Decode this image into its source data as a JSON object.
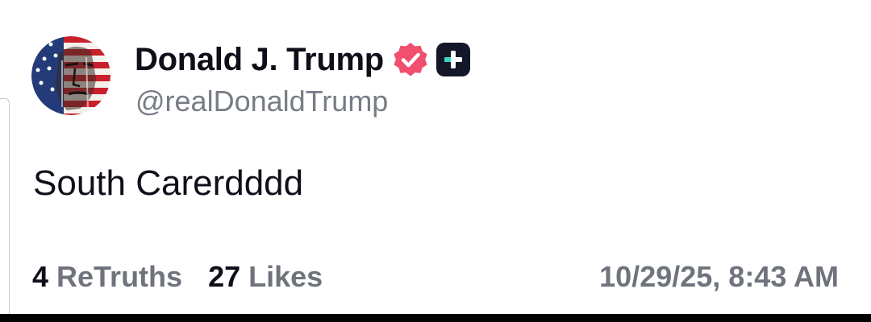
{
  "post": {
    "author": {
      "display_name": "Donald J. Trump",
      "handle": "@realDonaldTrump",
      "verified_icon": "verified-badge-icon",
      "verified_color": "#f0506e",
      "plus_icon": "plus-badge-icon",
      "plus_accent": "#39d8c4"
    },
    "text": "South Carerdddd",
    "stats": {
      "retruths_count": "4",
      "retruths_label": "ReTruths",
      "likes_count": "27",
      "likes_label": "Likes"
    },
    "timestamp": "10/29/25, 8:43 AM"
  }
}
